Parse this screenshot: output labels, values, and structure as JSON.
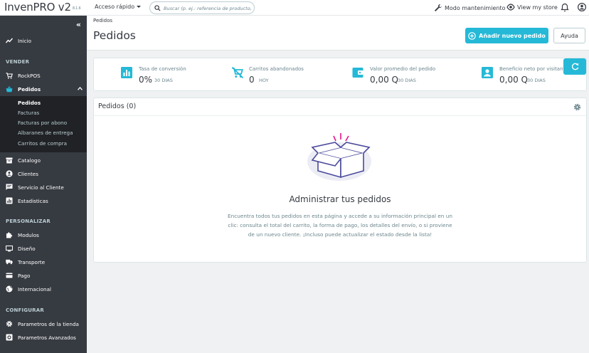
{
  "header": {
    "logo": "InvenPRO v2",
    "version": "8.1.6",
    "quick_access": "Acceso rápido",
    "search_placeholder": "Buscar (p. ej.: referencia de producto,",
    "maintenance": "Modo mantenimiento",
    "view_store": "View my store"
  },
  "sidebar": {
    "collapse": "«",
    "inicio": "Inicio",
    "section_vender": "VENDER",
    "rockpos": "RockPOS",
    "pedidos": "Pedidos",
    "sub": [
      "Pedidos",
      "Facturas",
      "Facturas por abono",
      "Albaranes de entrega",
      "Carritos de compra"
    ],
    "catalogo": "Catalogo",
    "clientes": "Clientes",
    "servicio": "Servicio al Cliente",
    "estadisticas": "Estadisticas",
    "section_personalizar": "PERSONALIZAR",
    "modulos": "Modulos",
    "diseno": "Diseño",
    "transporte": "Transporte",
    "pago": "Pago",
    "internacional": "Internacional",
    "section_configurar": "CONFIGURAR",
    "parametros_tienda": "Parametros de la tienda",
    "parametros_avanzados": "Parametros Avanzados"
  },
  "page": {
    "breadcrumb": "Pedidos",
    "title": "Pedidos",
    "add_order": "Añadir nuevo pedido",
    "help": "Ayuda"
  },
  "kpis": [
    {
      "title": "Tasa de conversión",
      "value": "0%",
      "sub": "30 DIAS"
    },
    {
      "title": "Carritos abandonados",
      "value": "0",
      "sub": "HOY"
    },
    {
      "title": "Valor promedio del pedido",
      "value": "0,00 Q",
      "sub": "30 DIAS"
    },
    {
      "title": "Beneficio neto por visitante",
      "value": "0,00 Q",
      "sub": "30 DIAS"
    }
  ],
  "orders": {
    "title": "Pedidos (0)",
    "empty_title": "Administrar tus pedidos",
    "empty_desc": "Encuentra todos tus pedidos en esta página y accede a su información principal en un clic: consulta el total del carrito, la forma de pago, los detalles del envío, o si proviene de un nuevo cliente. ¡Incluso puede actualizar el estado desde la lista!"
  },
  "colors": {
    "accent": "#25b9d7",
    "sidebar": "#363a41",
    "sidebar_sub": "#202226",
    "illustration": "#4b4a9b",
    "badge": "#e6128c"
  }
}
